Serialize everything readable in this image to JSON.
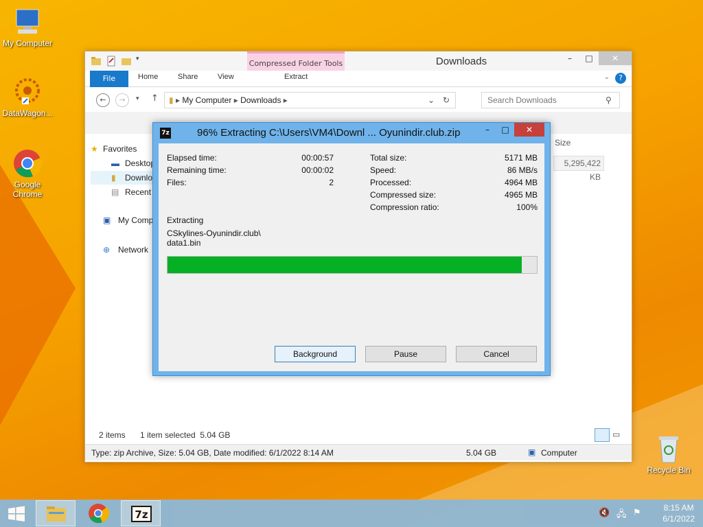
{
  "desktop": {
    "icons": [
      {
        "label": "My Computer"
      },
      {
        "label": "DataWagon..."
      },
      {
        "label": "Google Chrome"
      },
      {
        "label": "Recycle Bin"
      }
    ]
  },
  "explorer": {
    "title": "Downloads",
    "contextual_tab_title": "Compressed Folder Tools",
    "ribbon_tabs": [
      "File",
      "Home",
      "Share",
      "View",
      "Extract"
    ],
    "address": {
      "segments": [
        "My Computer",
        "Downloads"
      ]
    },
    "search_placeholder": "Search Downloads",
    "nav_pane": [
      "Favorites",
      "Desktop",
      "Downlo",
      "Recent p",
      "My Comp",
      "Network"
    ],
    "column_header": "Size",
    "size_value": "5,295,422 KB",
    "status": {
      "items": "2 items",
      "selected": "1 item selected  5.04 GB",
      "details": "Type: zip Archive, Size: 5.04 GB, Date modified: 6/1/2022 8:14 AM",
      "size": "5.04 GB",
      "location": "Computer"
    }
  },
  "dialog": {
    "logo": "7z",
    "title": "96% Extracting C:\\Users\\VM4\\Downl ... Oyunindir.club.zip",
    "left_stats": [
      {
        "label": "Elapsed time:",
        "value": "00:00:57"
      },
      {
        "label": "Remaining time:",
        "value": "00:00:02"
      },
      {
        "label": "Files:",
        "value": "2"
      }
    ],
    "right_stats": [
      {
        "label": "Total size:",
        "value": "5171 MB"
      },
      {
        "label": "Speed:",
        "value": "86 MB/s"
      },
      {
        "label": "Processed:",
        "value": "4964 MB"
      },
      {
        "label": "Compressed size:",
        "value": "4965 MB"
      },
      {
        "label": "Compression ratio:",
        "value": "100%"
      }
    ],
    "operation": "Extracting",
    "current_file_line1": "CSkylines-Oyunindir.club\\",
    "current_file_line2": "data1.bin",
    "progress_percent": 96,
    "buttons": {
      "background": "Background",
      "pause": "Pause",
      "cancel": "Cancel"
    }
  },
  "taskbar": {
    "time": "8:15 AM",
    "date": "6/1/2022",
    "items": [
      "start-button",
      "file-explorer",
      "chrome",
      "7zip"
    ]
  }
}
